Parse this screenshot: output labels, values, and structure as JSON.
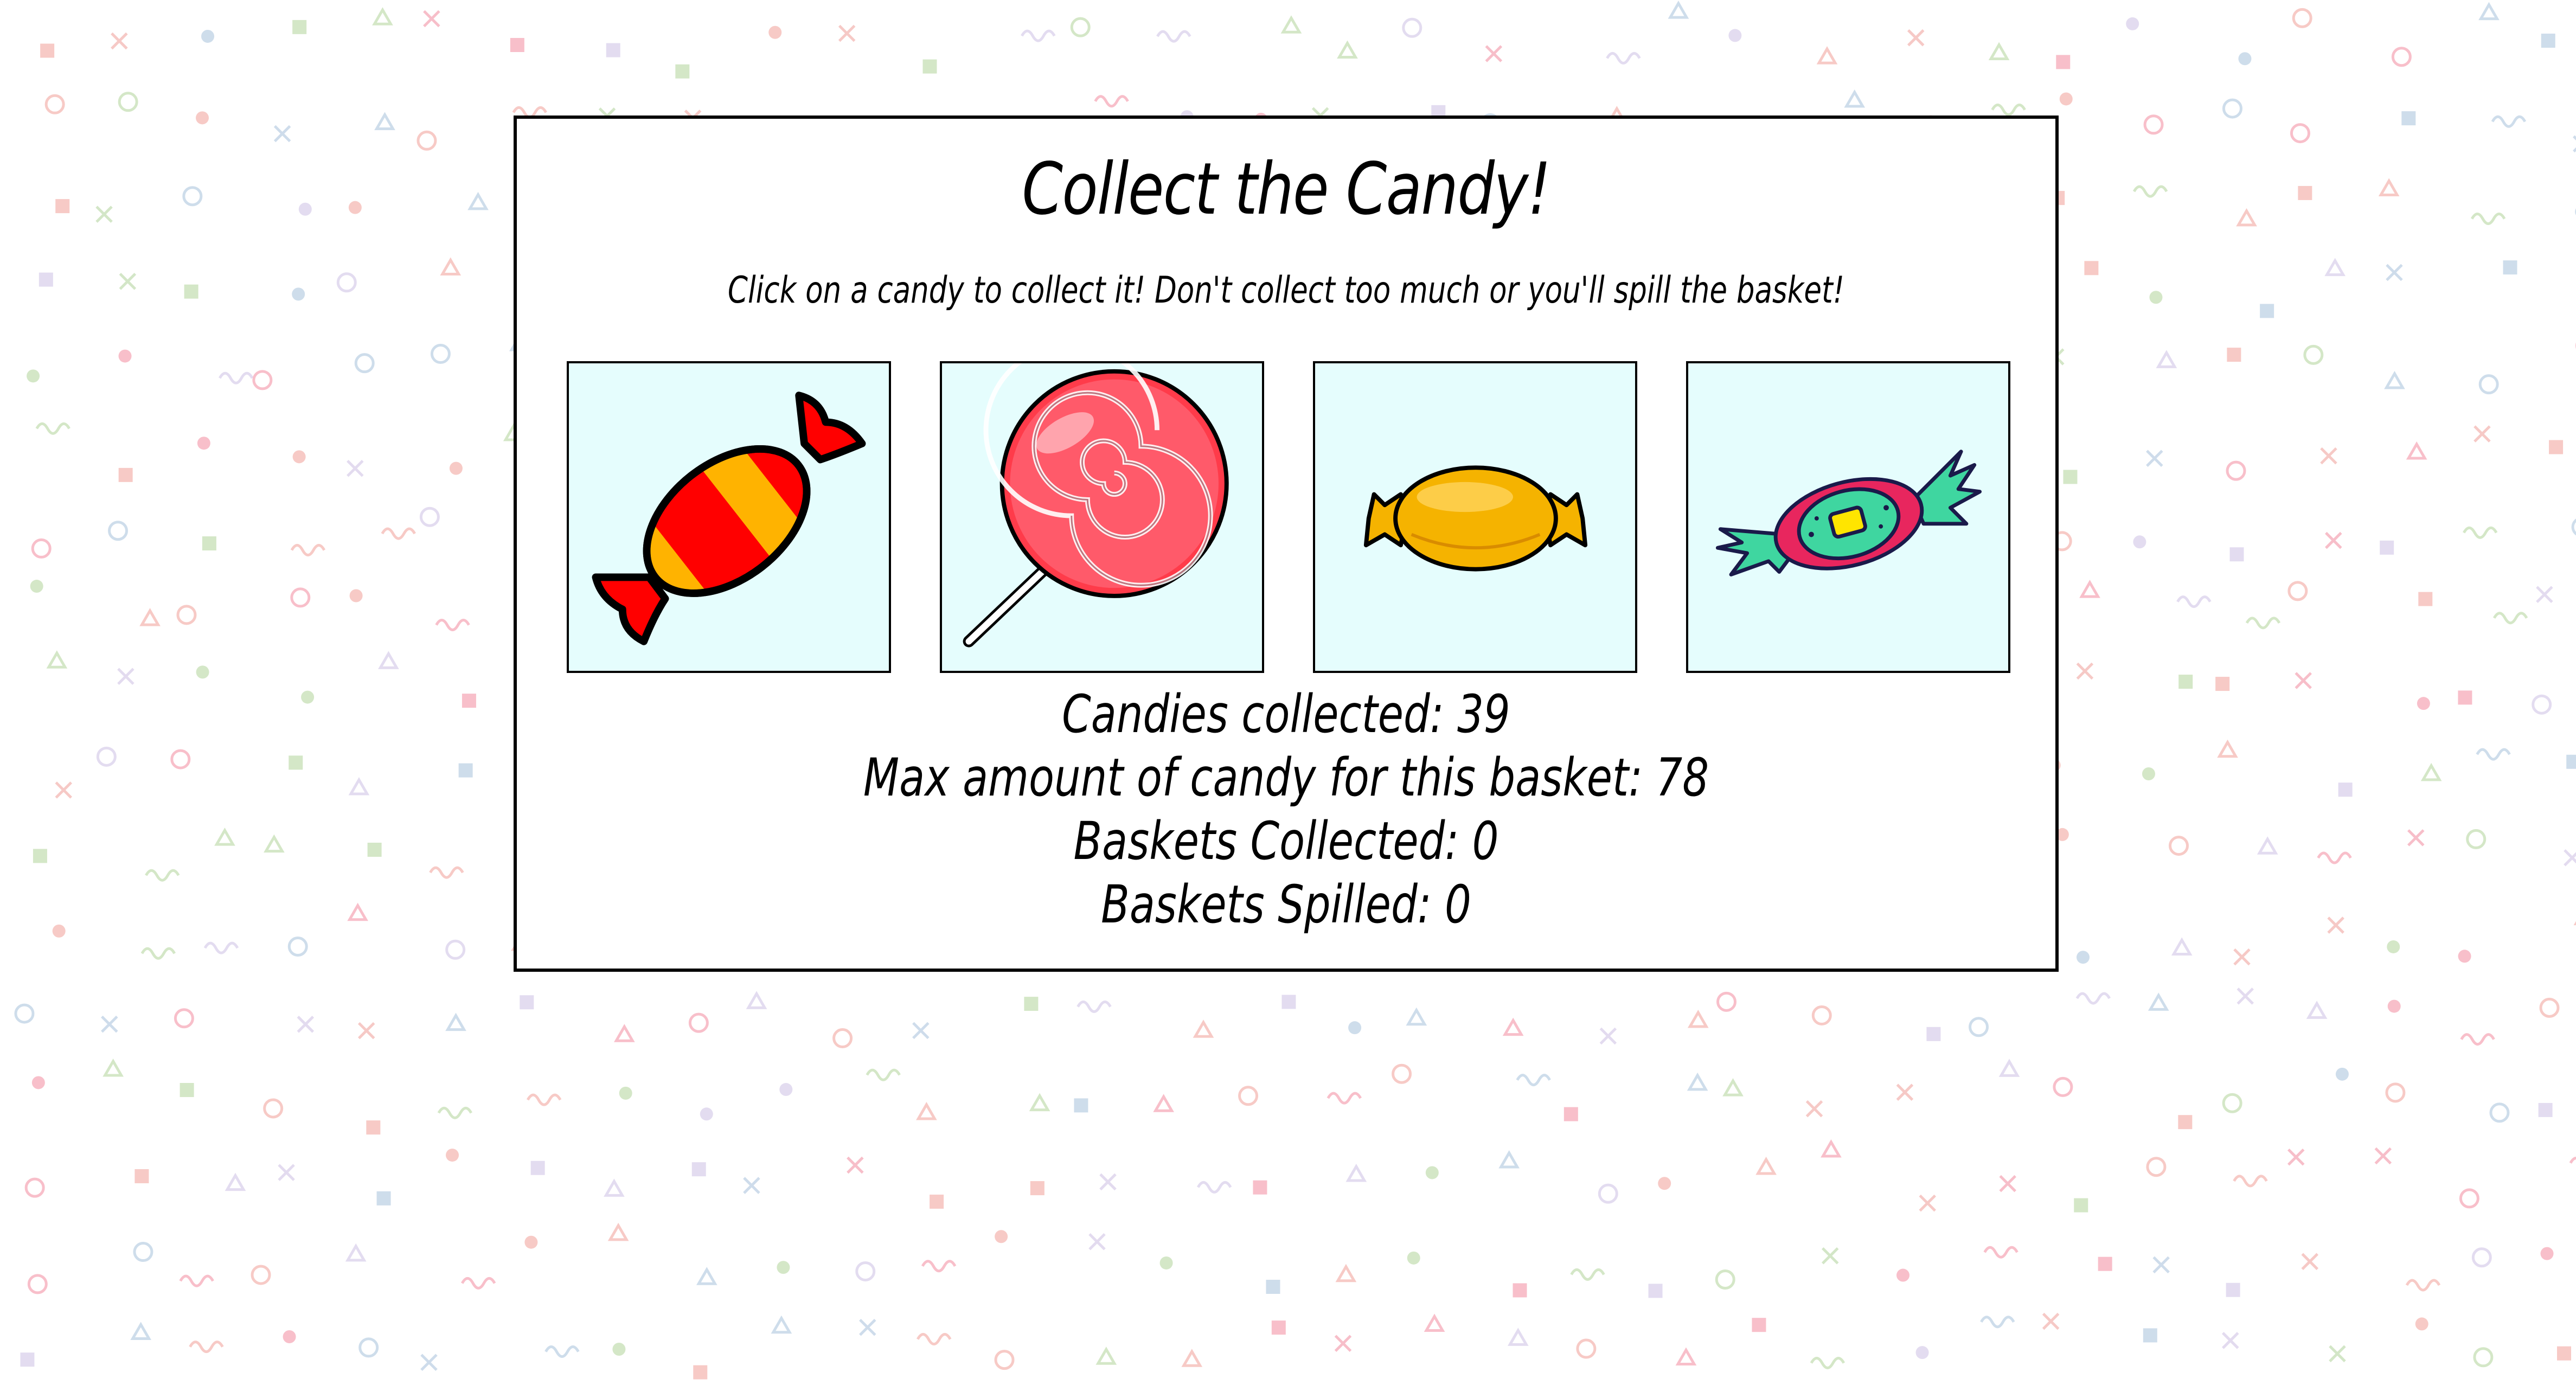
{
  "game": {
    "title": "Collect the Candy!",
    "instructions": "Click on a candy to collect it! Don't collect too much or you'll spill the basket!"
  },
  "candies": [
    {
      "name": "striped-wrapped-candy",
      "icon": "wrapped-candy-icon",
      "colors": [
        "#ff0000",
        "#ffb300",
        "#000000"
      ]
    },
    {
      "name": "lollipop",
      "icon": "lollipop-icon",
      "colors": [
        "#ff3b4a",
        "#ffffff",
        "#000000"
      ]
    },
    {
      "name": "butterscotch-candy",
      "icon": "butterscotch-icon",
      "colors": [
        "#f5b300",
        "#000000"
      ]
    },
    {
      "name": "green-wrapped-candy",
      "icon": "green-candy-icon",
      "colors": [
        "#3fd6a0",
        "#e8265e",
        "#ffe500"
      ]
    }
  ],
  "stats": {
    "candies_collected_label": "Candies collected: 39",
    "max_candy_label": "Max amount of candy for this basket: 78",
    "baskets_collected_label": "Baskets Collected: 0",
    "baskets_spilled_label": "Baskets Spilled: 0",
    "candies_collected": 39,
    "max_candy": 78,
    "baskets_collected": 0,
    "baskets_spilled": 0
  },
  "colors": {
    "card_background": "#e5fdfd",
    "panel_border": "#000000",
    "confetti": [
      "#f6c4c0",
      "#c9d9e9",
      "#cfe4c1",
      "#e0d8ee",
      "#f7b8c4"
    ]
  }
}
